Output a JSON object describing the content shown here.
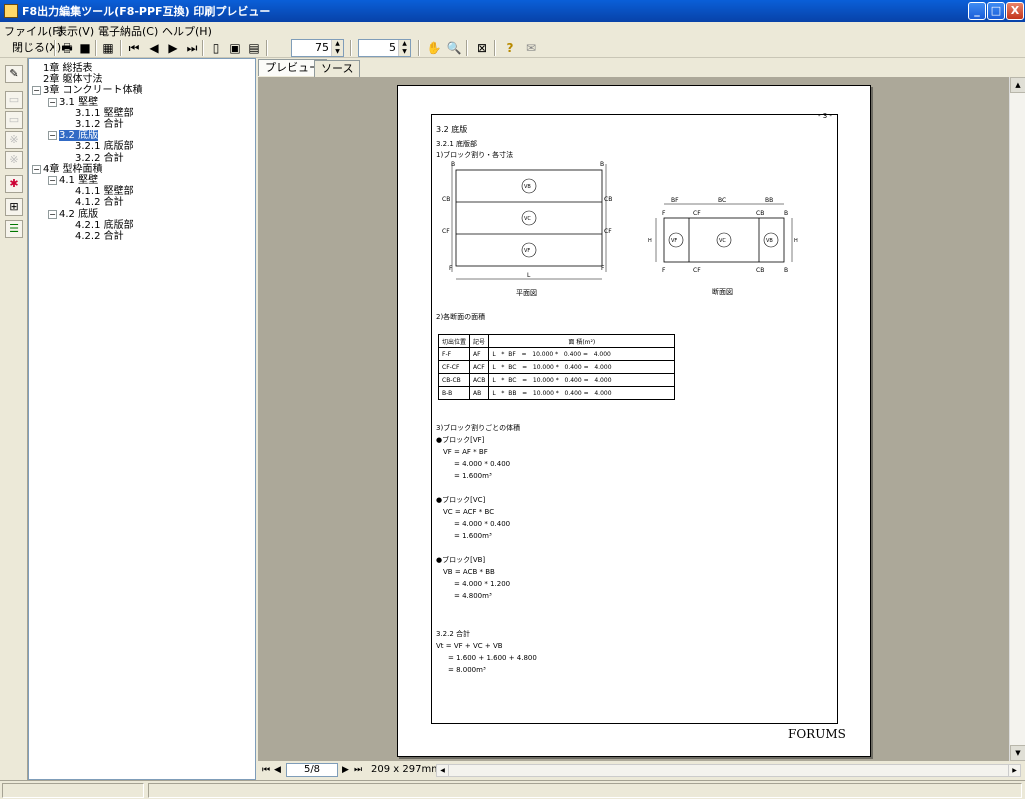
{
  "window": {
    "title": "F8出力編集ツール(F8-PPF互換) 印刷プレビュー",
    "buttons": {
      "minimize": "_",
      "maximize": "□",
      "close": "X"
    }
  },
  "menu": [
    "ファイル(F)",
    "表示(V)",
    "電子納品(C)",
    "ヘルプ(H)"
  ],
  "toolbar": {
    "close_label": "閉じる(X)",
    "zoom_value": "75",
    "page_value": "5",
    "icons": [
      "print-icon",
      "save-icon",
      "setup-icon",
      "first-page-icon",
      "prev-page-icon",
      "next-page-icon",
      "last-page-icon",
      "single-page-icon",
      "two-page-icon",
      "multi-page-icon",
      "hand-icon",
      "zoom-icon",
      "fit-icon",
      "help-icon",
      "mail-icon"
    ]
  },
  "tree": [
    {
      "label": "1章 総括表",
      "level": 0
    },
    {
      "label": "2章 躯体寸法",
      "level": 0
    },
    {
      "label": "3章 コンクリート体積",
      "level": 0,
      "expander": "−"
    },
    {
      "label": "3.1 堅壁",
      "level": 1,
      "expander": "−"
    },
    {
      "label": "3.1.1 堅壁部",
      "level": 2
    },
    {
      "label": "3.1.2 合計",
      "level": 2
    },
    {
      "label": "3.2 底版",
      "level": 1,
      "expander": "−",
      "selected": true
    },
    {
      "label": "3.2.1 底版部",
      "level": 2
    },
    {
      "label": "3.2.2 合計",
      "level": 2
    },
    {
      "label": "4章 型枠面積",
      "level": 0,
      "expander": "−"
    },
    {
      "label": "4.1 堅壁",
      "level": 1,
      "expander": "−"
    },
    {
      "label": "4.1.1 堅壁部",
      "level": 2
    },
    {
      "label": "4.1.2 合計",
      "level": 2
    },
    {
      "label": "4.2 底版",
      "level": 1,
      "expander": "−"
    },
    {
      "label": "4.2.1 底版部",
      "level": 2
    },
    {
      "label": "4.2.2 合計",
      "level": 2
    }
  ],
  "tabs": [
    "プレビュー",
    "ソース"
  ],
  "page": {
    "page_number": "- 3 -",
    "section": "3.2 底版",
    "subsection": "3.2.1 底版部",
    "item1": "1)ブロック割り・各寸法",
    "plan_caption": "平面図",
    "section_caption": "断面図",
    "plan_labels": {
      "b_top_left": "B",
      "b_top_right": "B",
      "cb_left": "CB",
      "cb_right": "CB",
      "cf_left": "CF",
      "cf_right": "CF",
      "f_left": "F",
      "f_right": "F",
      "vb": "VB",
      "vc": "VC",
      "vf": "VF",
      "l": "L"
    },
    "sect_labels": {
      "bf": "BF",
      "bc": "BC",
      "bb": "BB",
      "f": "F",
      "cf": "CF",
      "cb": "CB",
      "b": "B",
      "vf": "VF",
      "vc": "VC",
      "vb": "VB",
      "h": "H",
      "h2": "H"
    },
    "item2": "2)各断面の面積",
    "table": {
      "headers": [
        "切出位置",
        "記号",
        "面 積(m²)"
      ],
      "rows": [
        {
          "pos": "F-F",
          "sym": "AF",
          "formula": "L   *  BF   =   10.000 *   0.400 =   4.000"
        },
        {
          "pos": "CF-CF",
          "sym": "ACF",
          "formula": "L   *  BC   =   10.000 *   0.400 =   4.000"
        },
        {
          "pos": "CB-CB",
          "sym": "ACB",
          "formula": "L   *  BC   =   10.000 *   0.400 =   4.000"
        },
        {
          "pos": "B-B",
          "sym": "AB",
          "formula": "L   *  BB   =   10.000 *   0.400 =   4.000"
        }
      ]
    },
    "item3": "3)ブロック割りごとの体積",
    "blocks": [
      {
        "head": "●ブロック[VF]",
        "l1": "VF = AF * BF",
        "l2": "= 4.000 * 0.400",
        "l3": "= 1.600m³"
      },
      {
        "head": "●ブロック[VC]",
        "l1": "VC = ACF * BC",
        "l2": "= 4.000 * 0.400",
        "l3": "= 1.600m³"
      },
      {
        "head": "●ブロック[VB]",
        "l1": "VB = ACB * BB",
        "l2": "= 4.000 * 1.200",
        "l3": "= 4.800m³"
      }
    ],
    "subsection2": "3.2.2 合計",
    "sum": {
      "l1": "Vt = VF + VC + VB",
      "l2": "= 1.600 + 1.600 + 4.800",
      "l3": "= 8.000m³"
    },
    "footer_logo": "FORUMS"
  },
  "nav": {
    "page_indicator": "5/8",
    "paper_size": "209 x 297mm"
  }
}
